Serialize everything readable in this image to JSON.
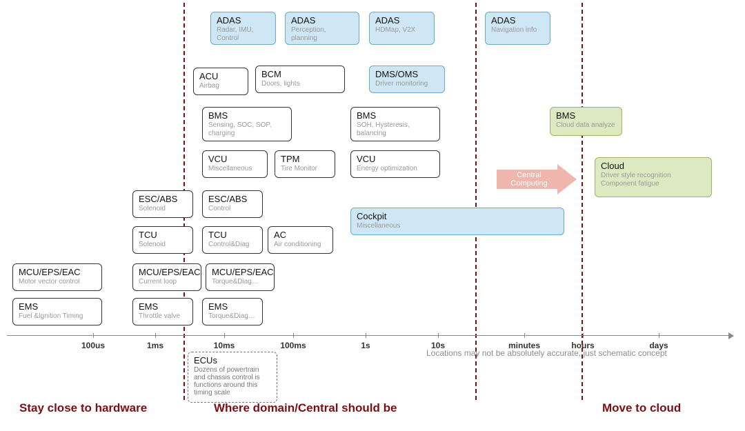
{
  "axis": {
    "ticks": [
      "100us",
      "1ms",
      "10ms",
      "100ms",
      "1s",
      "10s",
      "minutes",
      "hours",
      "days"
    ]
  },
  "regions": {
    "left": "Stay close to hardware",
    "mid": "Where domain/Central should be",
    "right": "Move to cloud"
  },
  "note_right": "Locations may not be absolutely accurate, just schematic concept",
  "ecu_note": {
    "title": "ECUs",
    "sub": "Dozens of powertrain and chassis control is functions around this timing scale"
  },
  "arrow": "Central Computing",
  "adas1": {
    "t": "ADAS",
    "s": "Radar, IMU, Control"
  },
  "adas2": {
    "t": "ADAS",
    "s": "Perception, planning"
  },
  "adas3": {
    "t": "ADAS",
    "s": "HDMap, V2X"
  },
  "adas4": {
    "t": "ADAS",
    "s": "Navigation info"
  },
  "acu": {
    "t": "ACU",
    "s": "Airbag"
  },
  "bcm": {
    "t": "BCM",
    "s": "Doors, lights"
  },
  "dms": {
    "t": "DMS/OMS",
    "s": "Driver monitoring"
  },
  "bms1": {
    "t": "BMS",
    "s": "Sensing, SOC, SOP, charging"
  },
  "bms2": {
    "t": "BMS",
    "s": "SOH, Hysteresis, balancing"
  },
  "bms3": {
    "t": "BMS",
    "s": "Cloud data analyze"
  },
  "vcu1": {
    "t": "VCU",
    "s": "Miscellaneous"
  },
  "tpm": {
    "t": "TPM",
    "s": "Tire Monitor"
  },
  "vcu2": {
    "t": "VCU",
    "s": "Energy optimization"
  },
  "cloud": {
    "t": "Cloud",
    "s": "Driver style recognition\nComponent fatigue"
  },
  "esc1": {
    "t": "ESC/ABS",
    "s": "Solenoid"
  },
  "esc2": {
    "t": "ESC/ABS",
    "s": "Control"
  },
  "cockpit": {
    "t": "Cockpit",
    "s": "Miscellaneous"
  },
  "tcu1": {
    "t": "TCU",
    "s": "Solenoid"
  },
  "tcu2": {
    "t": "TCU",
    "s": "Control&Diag"
  },
  "ac": {
    "t": "AC",
    "s": "Air conditioning"
  },
  "mcu0": {
    "t": "MCU/EPS/EAC",
    "s": "Motor vector control"
  },
  "mcu1": {
    "t": "MCU/EPS/EAC",
    "s": "Current loop"
  },
  "mcu2": {
    "t": "MCU/EPS/EAC",
    "s": "Torque&Diag…"
  },
  "ems0": {
    "t": "EMS",
    "s": "Fuel &Ignition Timing"
  },
  "ems1": {
    "t": "EMS",
    "s": "Throttle valve"
  },
  "ems2": {
    "t": "EMS",
    "s": "Torque&Diag…"
  }
}
